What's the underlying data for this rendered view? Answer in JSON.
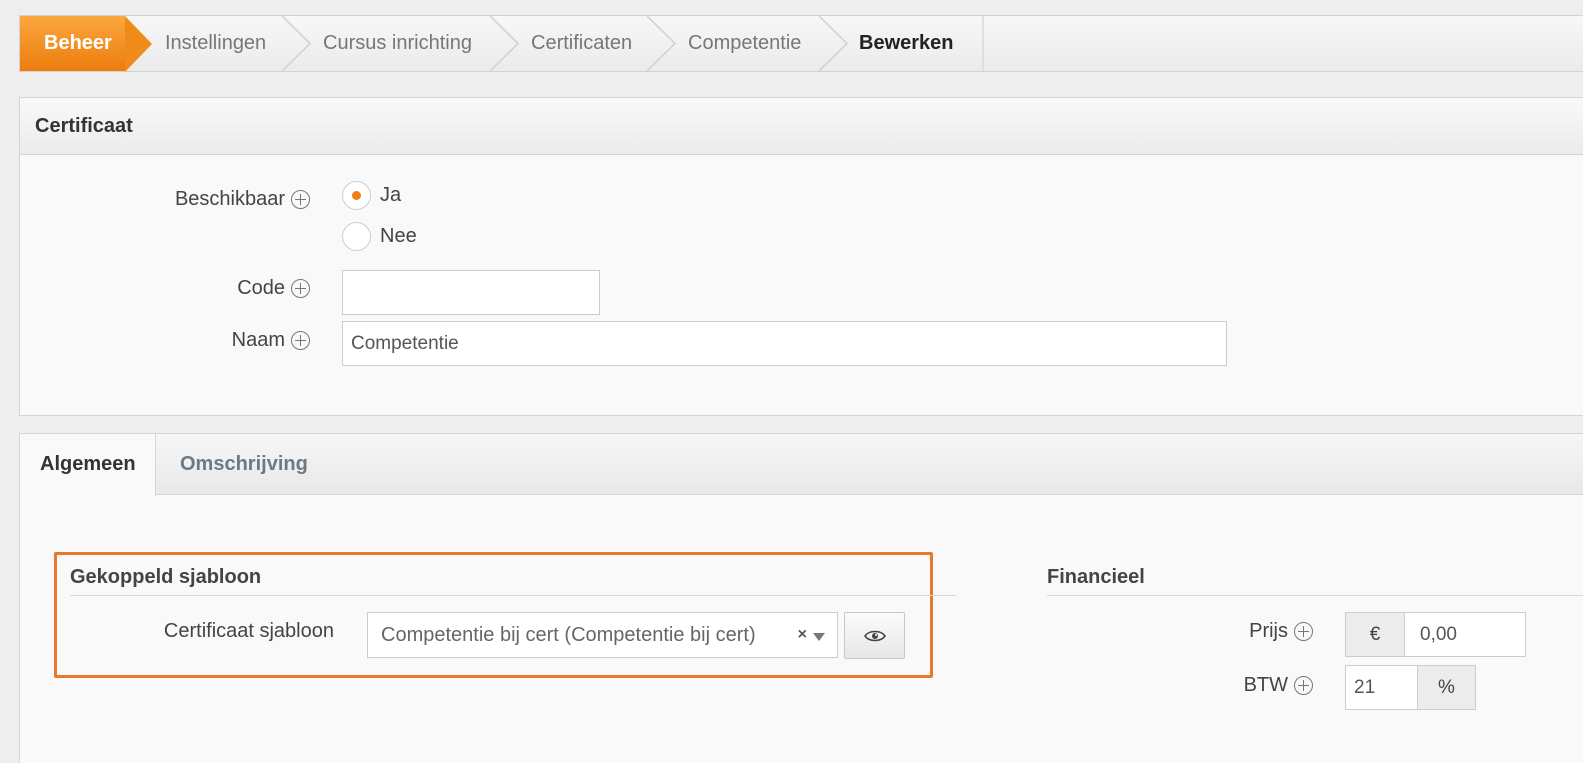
{
  "breadcrumb": {
    "items": [
      "Beheer",
      "Instellingen",
      "Cursus inrichting",
      "Certificaten",
      "Competentie",
      "Bewerken"
    ]
  },
  "certificaat_panel": {
    "title": "Certificaat",
    "beschikbaar_label": "Beschikbaar",
    "radio_ja": "Ja",
    "radio_nee": "Nee",
    "selected": "Ja",
    "code_label": "Code",
    "code_value": "",
    "naam_label": "Naam",
    "naam_value": "Competentie"
  },
  "tabs": [
    {
      "label": "Algemeen",
      "active": true
    },
    {
      "label": "Omschrijving",
      "active": false
    }
  ],
  "gekoppeld": {
    "title": "Gekoppeld sjabloon",
    "sjabloon_label": "Certificaat sjabloon",
    "sjabloon_value": "Competentie bij cert (Competentie bij cert)",
    "clear_glyph": "×"
  },
  "financieel": {
    "title": "Financieel",
    "prijs_label": "Prijs",
    "currency": "€",
    "prijs_value": "0,00",
    "btw_label": "BTW",
    "btw_value": "21",
    "btw_unit": "%"
  },
  "colors": {
    "accent": "#f07f12",
    "highlight_border": "#e8782a"
  }
}
